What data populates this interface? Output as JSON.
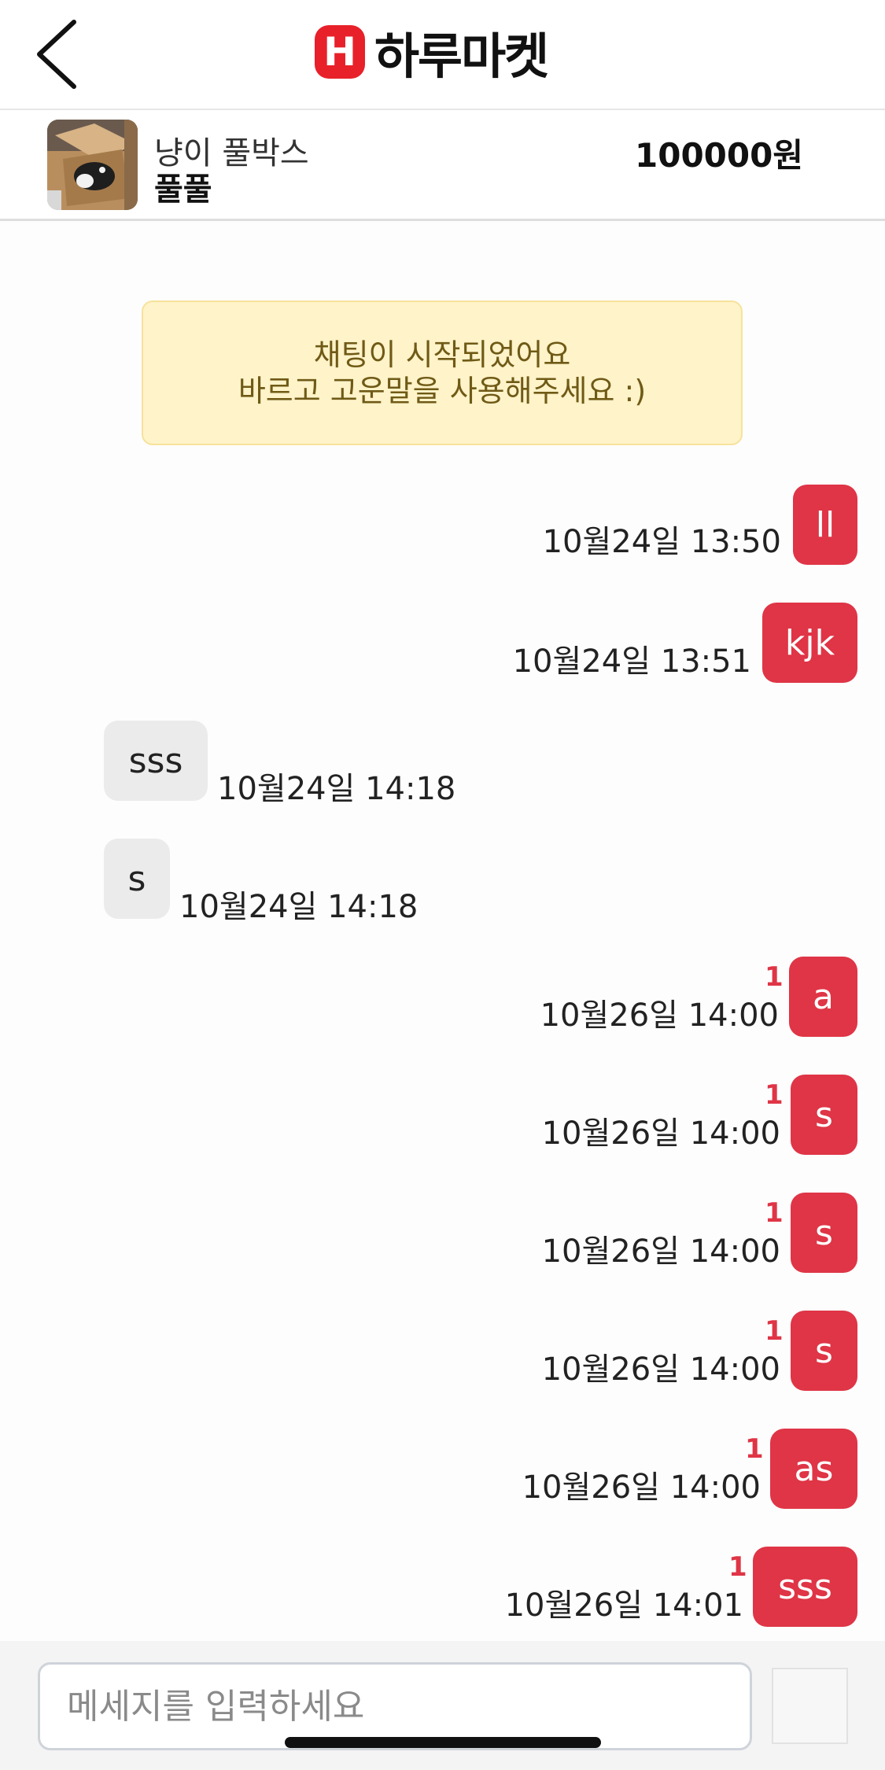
{
  "header": {
    "back_icon": "chevron-left-icon",
    "logo_mark": "H",
    "logo_text": "하루마켓"
  },
  "product": {
    "name": "냥이 풀박스",
    "seller": "풀풀",
    "price": "100000원"
  },
  "notice": {
    "line1": "채팅이 시작되었어요",
    "line2": "바르고 고운말을 사용해주세요 :)"
  },
  "messages": [
    {
      "from": "me",
      "text": "ll",
      "time": "10월24일 13:50",
      "unread": ""
    },
    {
      "from": "me",
      "text": "kjk",
      "time": "10월24일 13:51",
      "unread": ""
    },
    {
      "from": "them",
      "text": "sss",
      "time": "10월24일 14:18",
      "unread": ""
    },
    {
      "from": "them",
      "text": "s",
      "time": "10월24일 14:18",
      "unread": ""
    },
    {
      "from": "me",
      "text": "a",
      "time": "10월26일 14:00",
      "unread": "1"
    },
    {
      "from": "me",
      "text": "s",
      "time": "10월26일 14:00",
      "unread": "1"
    },
    {
      "from": "me",
      "text": "s",
      "time": "10월26일 14:00",
      "unread": "1"
    },
    {
      "from": "me",
      "text": "s",
      "time": "10월26일 14:00",
      "unread": "1"
    },
    {
      "from": "me",
      "text": "as",
      "time": "10월26일 14:00",
      "unread": "1"
    },
    {
      "from": "me",
      "text": "sss",
      "time": "10월26일 14:01",
      "unread": "1"
    }
  ],
  "input": {
    "placeholder": "메세지를 입력하세요",
    "value": ""
  },
  "colors": {
    "accent": "#df3546",
    "logo": "#e8202a",
    "notice_bg": "#fff3c9",
    "incoming_bubble": "#ebebeb"
  }
}
